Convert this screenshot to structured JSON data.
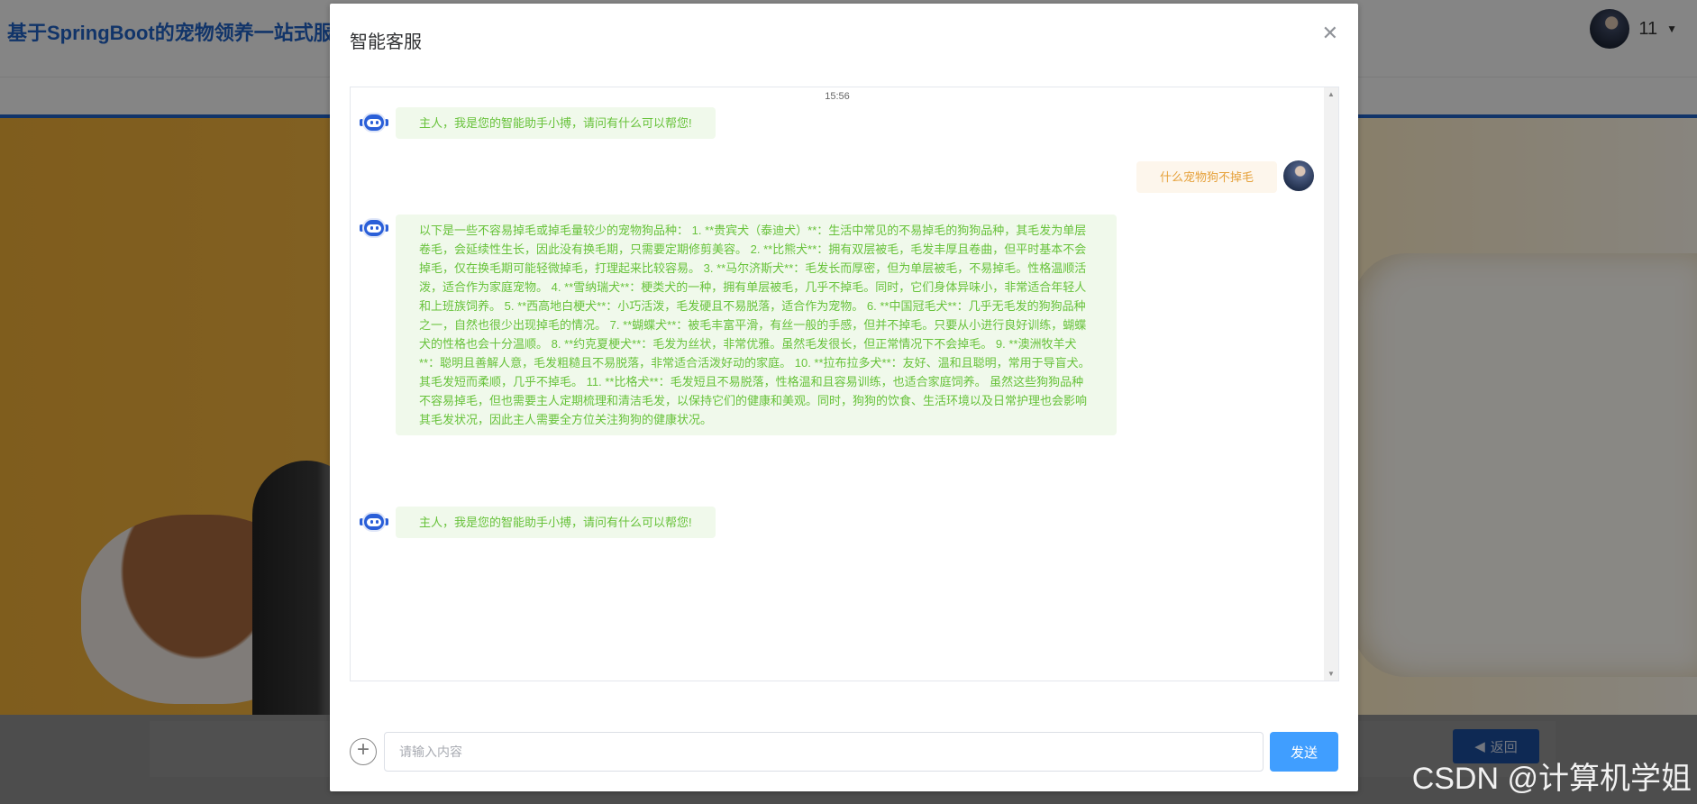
{
  "page": {
    "site_title": "基于SpringBoot的宠物领养一站式服",
    "user_name": "11",
    "back_label": "返回",
    "watermark": "CSDN @计算机学姐"
  },
  "modal": {
    "title": "智能客服",
    "close_icon": "close-icon"
  },
  "chat": {
    "timestamp": "15:56",
    "messages": [
      {
        "role": "bot",
        "text": "主人，我是您的智能助手小搏，请问有什么可以帮您!"
      },
      {
        "role": "user",
        "text": "什么宠物狗不掉毛"
      },
      {
        "role": "bot",
        "text": "以下是一些不容易掉毛或掉毛量较少的宠物狗品种： 1. **贵宾犬（泰迪犬）**：生活中常见的不易掉毛的狗狗品种，其毛发为单层卷毛，会延续性生长，因此没有换毛期，只需要定期修剪美容。 2. **比熊犬**：拥有双层被毛，毛发丰厚且卷曲，但平时基本不会掉毛，仅在换毛期可能轻微掉毛，打理起来比较容易。 3. **马尔济斯犬**：毛发长而厚密，但为单层被毛，不易掉毛。性格温顺活泼，适合作为家庭宠物。 4. **雪纳瑞犬**：梗类犬的一种，拥有单层被毛，几乎不掉毛。同时，它们身体异味小，非常适合年轻人和上班族饲养。 5. **西高地白梗犬**：小巧活泼，毛发硬且不易脱落，适合作为宠物。 6. **中国冠毛犬**：几乎无毛发的狗狗品种之一，自然也很少出现掉毛的情况。 7. **蝴蝶犬**：被毛丰富平滑，有丝一般的手感，但并不掉毛。只要从小进行良好训练，蝴蝶犬的性格也会十分温顺。 8. **约克夏梗犬**：毛发为丝状，非常优雅。虽然毛发很长，但正常情况下不会掉毛。 9. **澳洲牧羊犬**：聪明且善解人意，毛发粗糙且不易脱落，非常适合活泼好动的家庭。 10. **拉布拉多犬**：友好、温和且聪明，常用于导盲犬。其毛发短而柔顺，几乎不掉毛。 11. **比格犬**：毛发短且不易脱落，性格温和且容易训练，也适合家庭饲养。 虽然这些狗狗品种不容易掉毛，但也需要主人定期梳理和清洁毛发，以保持它们的健康和美观。同时，狗狗的饮食、生活环境以及日常护理也会影响其毛发状况，因此主人需要全方位关注狗狗的健康状况。"
      },
      {
        "role": "bot",
        "text": "主人，我是您的智能助手小搏，请问有什么可以帮您!"
      }
    ]
  },
  "input": {
    "placeholder": "请输入内容",
    "value": "",
    "send_label": "发送"
  },
  "colors": {
    "bot_bubble_bg": "#f0f9eb",
    "bot_text": "#67c23a",
    "user_bubble_bg": "#fdf6ec",
    "user_text": "#e6a23c",
    "send_button": "#409eff",
    "site_title": "#1f5fbf"
  }
}
